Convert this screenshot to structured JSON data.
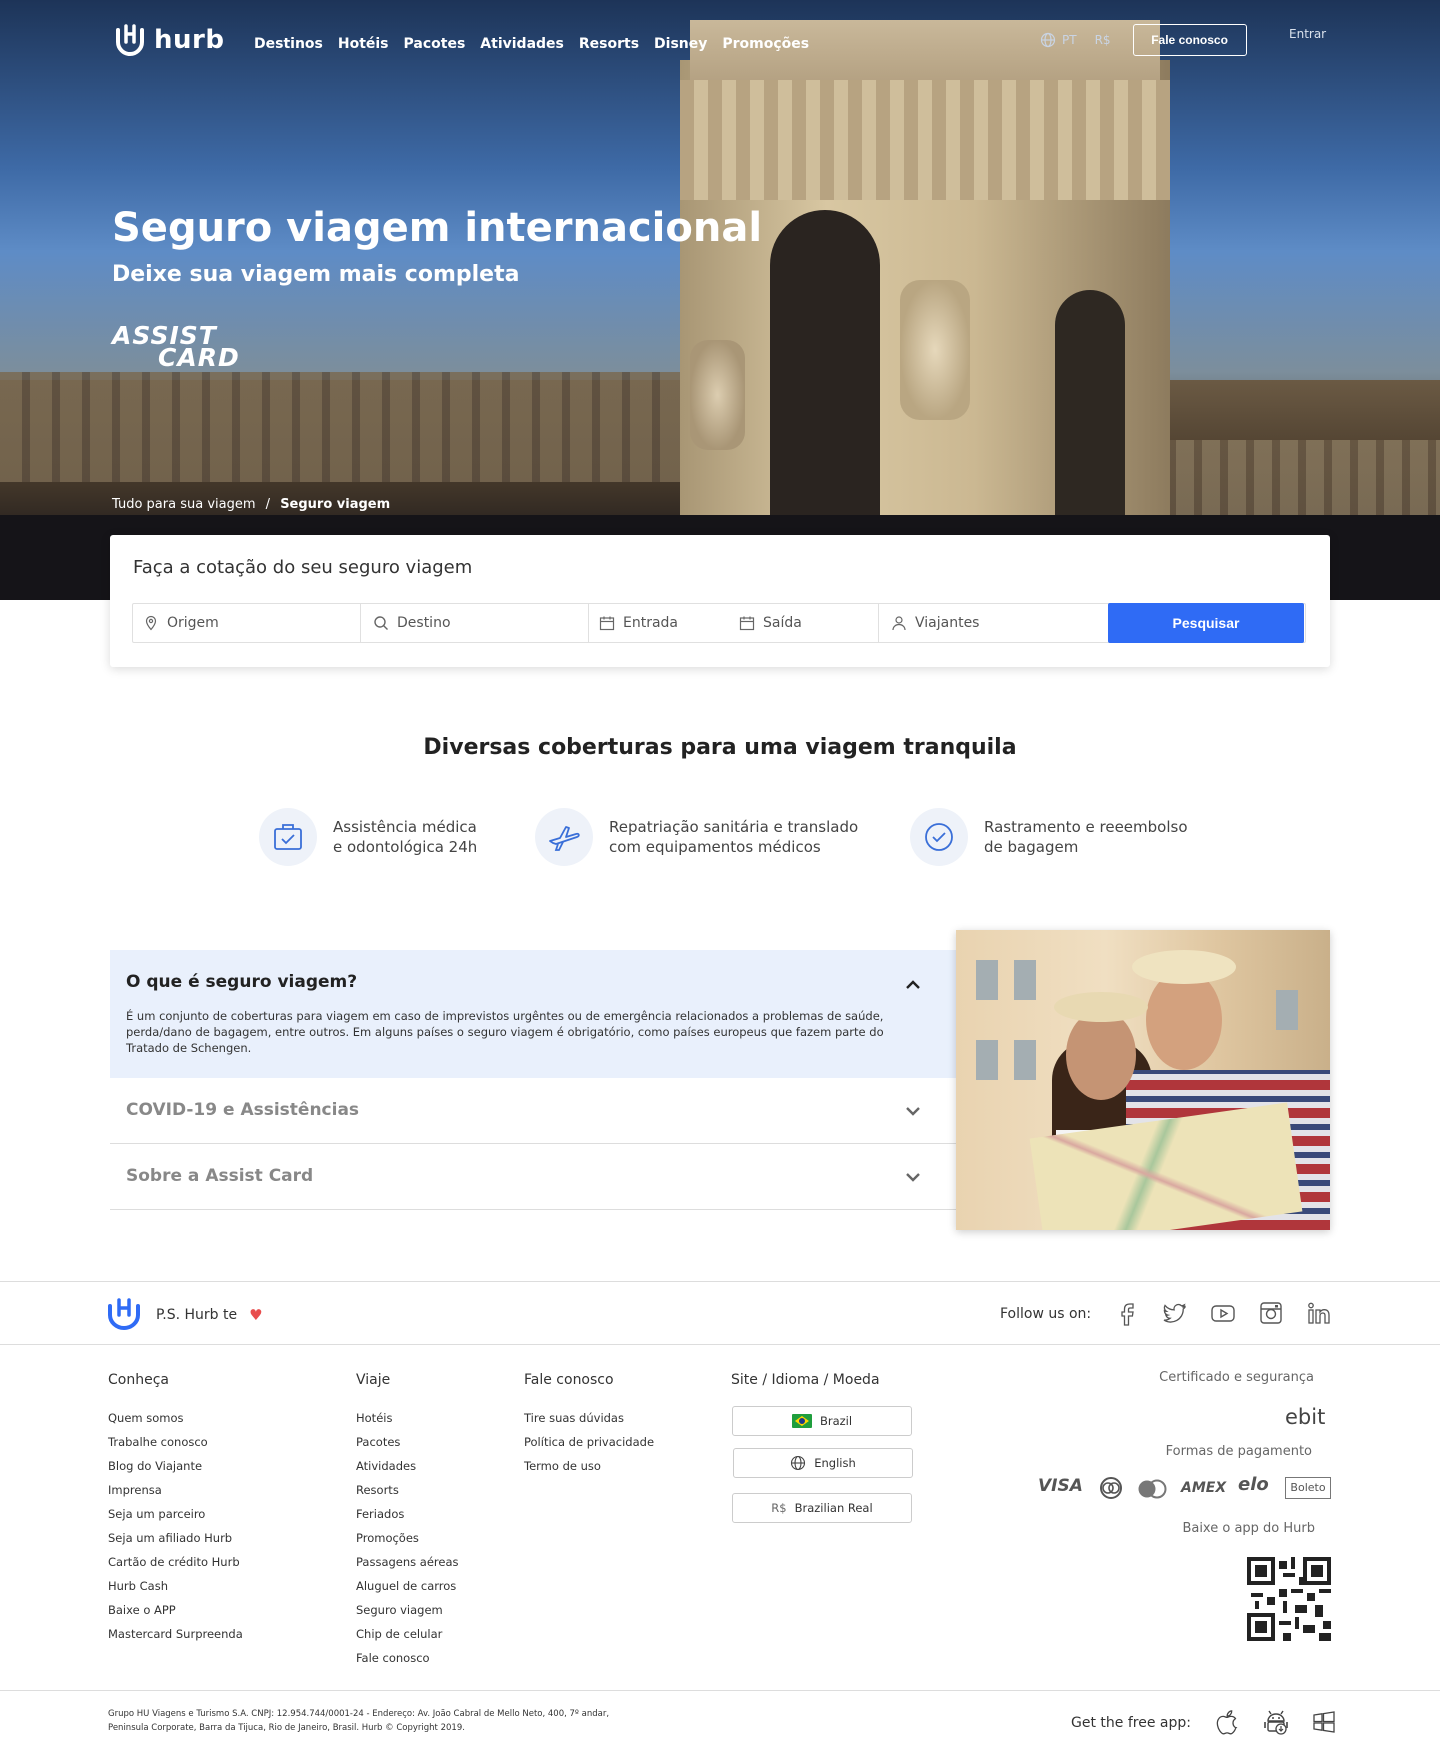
{
  "brand": {
    "name": "hurb"
  },
  "nav": [
    "Destinos",
    "Hotéis",
    "Pacotes",
    "Atividades",
    "Resorts",
    "Disney",
    "Promoções"
  ],
  "header": {
    "lang_code": "PT",
    "currency": "R$",
    "contact_button": "Fale conosco",
    "login": "Entrar"
  },
  "hero": {
    "title": "Seguro viagem internacional",
    "subtitle": "Deixe sua viagem mais completa",
    "partner_logo_line1": "ASSIST",
    "partner_logo_line2": "CARD",
    "breadcrumb_root": "Tudo para sua viagem",
    "breadcrumb_sep": "/",
    "breadcrumb_current": "Seguro viagem"
  },
  "search": {
    "title": "Faça a cotação do seu seguro viagem",
    "origin_placeholder": "Origem",
    "destination_placeholder": "Destino",
    "checkin_placeholder": "Entrada",
    "checkout_placeholder": "Saída",
    "travelers_placeholder": "Viajantes",
    "submit": "Pesquisar"
  },
  "coverages": {
    "title": "Diversas coberturas para uma viagem tranquila",
    "items": [
      {
        "icon": "medical-kit-icon",
        "line1": "Assistência médica",
        "line2": "e odontológica 24h"
      },
      {
        "icon": "airplane-icon",
        "line1": "Repatriação sanitária e translado",
        "line2": "com equipamentos médicos"
      },
      {
        "icon": "check-circle-icon",
        "line1": "Rastramento e reeembolso",
        "line2": "de bagagem"
      }
    ]
  },
  "faq": {
    "open_question": "O que é seguro viagem?",
    "open_answer": "É um conjunto de coberturas para viagem em caso de imprevistos urgêntes ou de emergência relacionados a problemas de saúde, perda/dano de bagagem, entre outros. Em alguns países o seguro viagem é obrigatório, como países europeus que fazem parte do Tratado de Schengen.",
    "items": [
      "COVID-19 e Assistências",
      "Sobre a Assist Card"
    ]
  },
  "footer": {
    "ps_text": "P.S. Hurb te",
    "heart": "♥",
    "follow": "Follow us on:",
    "socials": [
      "facebook-icon",
      "twitter-icon",
      "youtube-icon",
      "instagram-icon",
      "linkedin-icon"
    ],
    "col_conheca": {
      "title": "Conheça",
      "links": [
        "Quem somos",
        "Trabalhe conosco",
        "Blog do Viajante",
        "Imprensa",
        "Seja um parceiro",
        "Seja um afiliado Hurb",
        "Cartão de crédito Hurb",
        "Hurb Cash",
        "Baixe o APP",
        "Mastercard Surpreenda"
      ]
    },
    "col_viaje": {
      "title": "Viaje",
      "links": [
        "Hotéis",
        "Pacotes",
        "Atividades",
        "Resorts",
        "Feriados",
        "Promoções",
        "Passagens aéreas",
        "Aluguel de carros",
        "Seguro viagem",
        "Chip de celular",
        "Fale conosco"
      ]
    },
    "col_fale": {
      "title": "Fale conosco",
      "links": [
        "Tire suas dúvidas",
        "Política de privacidade",
        "Termo de uso"
      ]
    },
    "col_site": {
      "title": "Site / Idioma / Moeda",
      "country": "Brazil",
      "language": "English",
      "currency_symbol": "R$",
      "currency": "Brazilian Real"
    },
    "cert_title": "Certificado e segurança",
    "ebit": "ebit",
    "payment_title": "Formas de pagamento",
    "payments": [
      "VISA",
      "AMEX",
      "elo",
      "Boleto"
    ],
    "app_title": "Baixe o app do Hurb",
    "legal": "Grupo HU Viagens e Turismo S.A. CNPJ: 12.954.744/0001-24 - Endereço: Av. João Cabral de Mello Neto, 400, 7º andar, Peninsula Corporate, Barra da Tijuca, Rio de Janeiro, Brasil. Hurb © Copyright 2019.",
    "get_app": "Get the free app:"
  },
  "colors": {
    "accent": "#2f6bf5",
    "brand_white": "#ffffff",
    "faq_bg": "#e9f0fc",
    "icon_blue": "#3a6fd8",
    "heart": "#e84d4d"
  }
}
